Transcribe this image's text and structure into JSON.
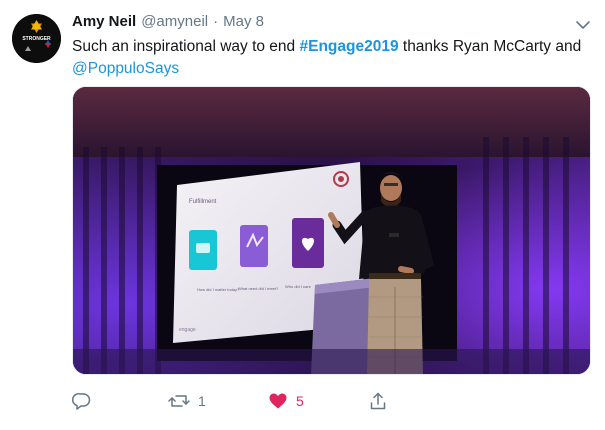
{
  "tweet": {
    "author_name": "Amy Neil",
    "author_handle": "@amyneil",
    "separator": "·",
    "date": "May 8",
    "text_before": "Such an inspirational way to end ",
    "hashtag": "#Engage2019",
    "text_middle": " thanks Ryan McCarty and ",
    "mention": "@PoppuloSays",
    "avatar_text": "STRONGER"
  },
  "slide": {
    "title": "Fulfillment",
    "captions": [
      "How did I matter today?",
      "What need did I meet?",
      "Who did I care"
    ],
    "footer": "engage"
  },
  "actions": {
    "reply_count": "",
    "retweet_count": "1",
    "like_count": "5",
    "liked": true
  },
  "colors": {
    "link": "#1b95e0",
    "like": "#e0245e",
    "secondary": "#657786"
  },
  "icons": [
    "chevron-down-icon",
    "reply-icon",
    "retweet-icon",
    "heart-icon",
    "share-icon"
  ]
}
